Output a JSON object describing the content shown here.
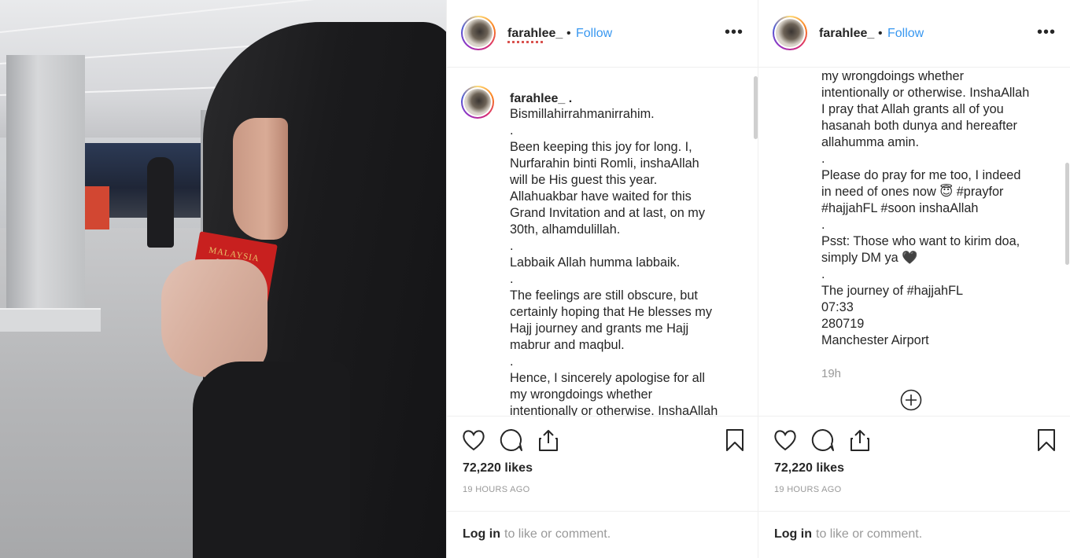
{
  "post": {
    "username": "farahlee_",
    "separator": "•",
    "follow_label": "Follow",
    "more_label": "•••",
    "likes": "72,220 likes",
    "time": "19 HOURS AGO",
    "login_link": "Log in",
    "login_rest": "to like or comment."
  },
  "panel1": {
    "caption_user": "farahlee_ .",
    "caption": "Bismillahirrahmanirrahim.\n.\nBeen keeping this joy for long. I,\nNurfarahin binti Romli, inshaAllah\nwill be His guest this year.\nAllahuakbar have waited for this\nGrand Invitation and at last, on my\n30th, alhamdulillah.\n.\nLabbaik Allah humma labbaik.\n.\nThe feelings are still obscure, but\ncertainly hoping that He blesses my\nHajj journey and grants me Hajj\nmabrur and maqbul.\n.\nHence, I sincerely apologise for all\nmy wrongdoings whether\nintentionally or otherwise. InshaAllah"
  },
  "panel2": {
    "caption": "my wrongdoings whether\nintentionally or otherwise. InshaAllah\nI pray that Allah grants all of you\nhasanah both dunya and hereafter\nallahumma amin.\n.\nPlease do pray for me too, I indeed\nin need of ones now 😇 #prayfor\n#hajjahFL #soon inshaAllah\n.\nPsst: Those who want to kirim doa,\nsimply DM ya 🖤\n.\nThe journey of #hajjahFL\n07:33\n280719\nManchester Airport",
    "relative_time": "19h"
  },
  "photo": {
    "passport_text": "MALAYSIA"
  },
  "icons": {
    "like": "heart-icon",
    "comment": "comment-icon",
    "share": "share-icon",
    "save": "bookmark-icon",
    "add": "add-comment-icon"
  },
  "colors": {
    "follow": "#3897f0",
    "muted": "#999999",
    "text": "#262626"
  }
}
